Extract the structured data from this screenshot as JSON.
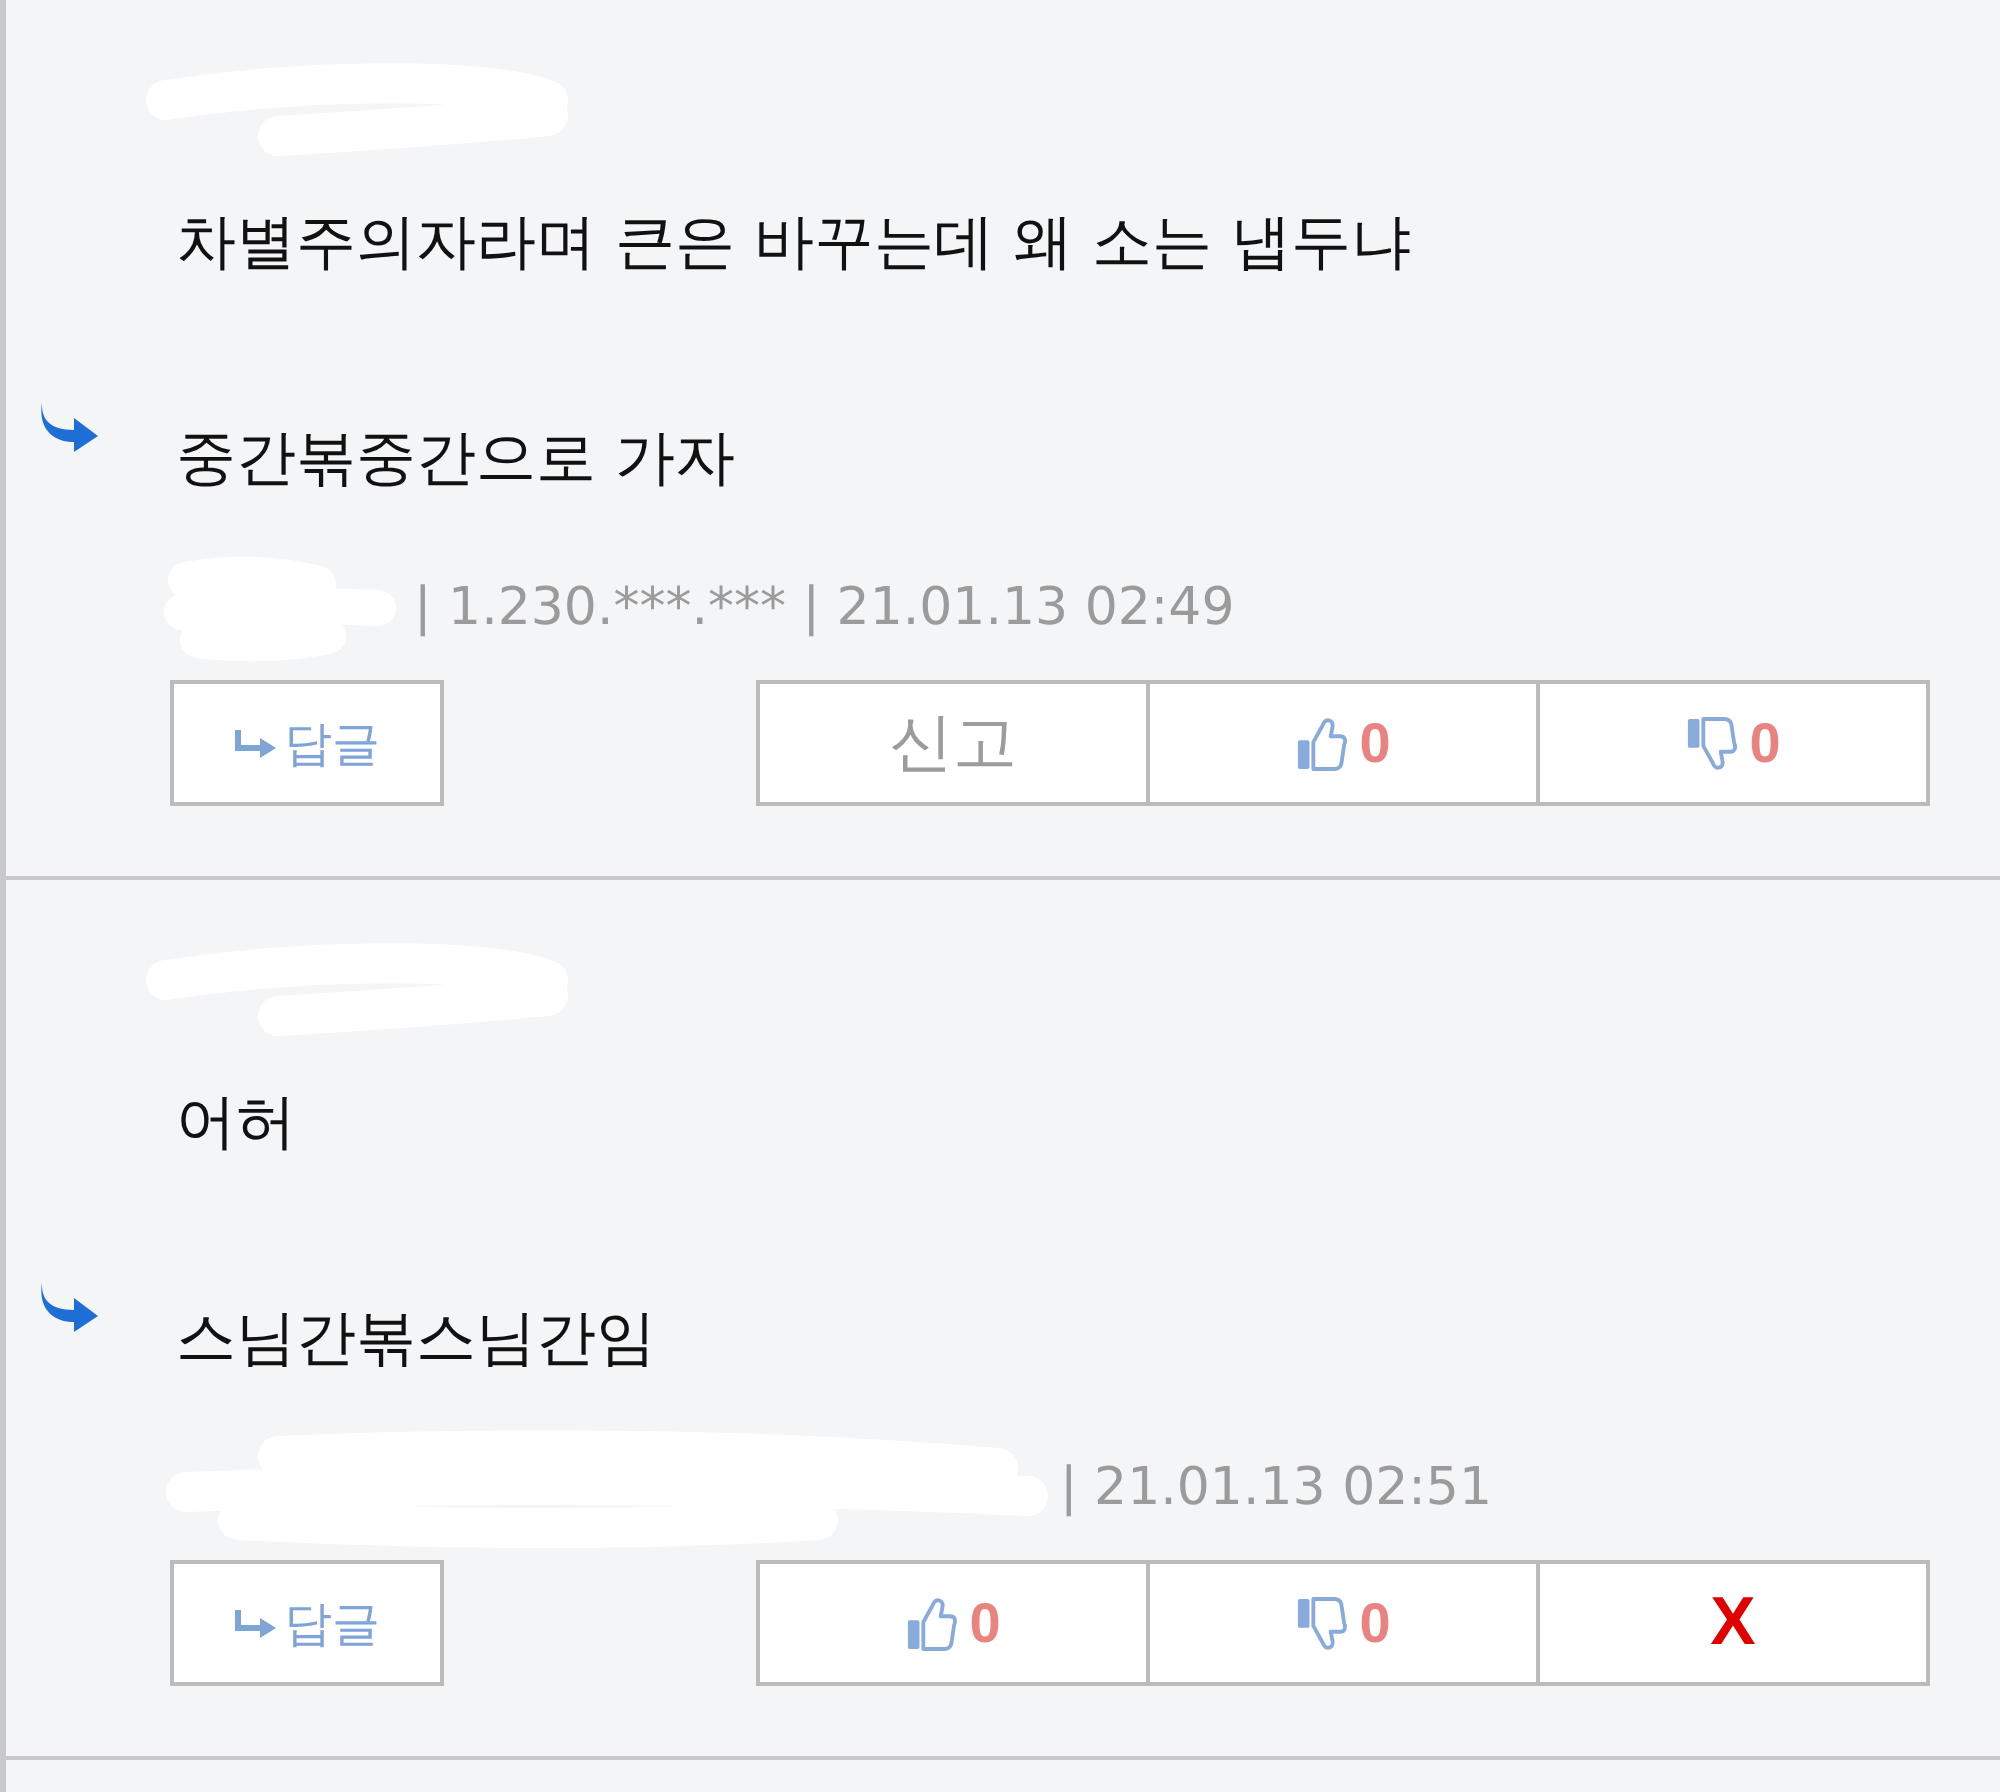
{
  "comments": [
    {
      "author_redacted": true,
      "body": "차별주의자라며 큰은 바꾸는데 왜 소는 냅두냐",
      "reply": "중간볶중간으로 가자",
      "meta_redaction": {
        "kind": "short"
      },
      "meta": "| 1.230.***.*** | 21.01.13 02:49",
      "reply_button": "답글",
      "actions": [
        {
          "kind": "report",
          "label": "신고"
        },
        {
          "kind": "like",
          "count": "0"
        },
        {
          "kind": "dislike",
          "count": "0"
        }
      ]
    },
    {
      "author_redacted": true,
      "body": "어허",
      "reply": "스님간볶스님간임",
      "meta_redaction": {
        "kind": "long"
      },
      "meta": "| 21.01.13 02:51",
      "reply_button": "답글",
      "actions": [
        {
          "kind": "like",
          "count": "0"
        },
        {
          "kind": "dislike",
          "count": "0"
        },
        {
          "kind": "delete",
          "label": "X"
        }
      ]
    }
  ]
}
